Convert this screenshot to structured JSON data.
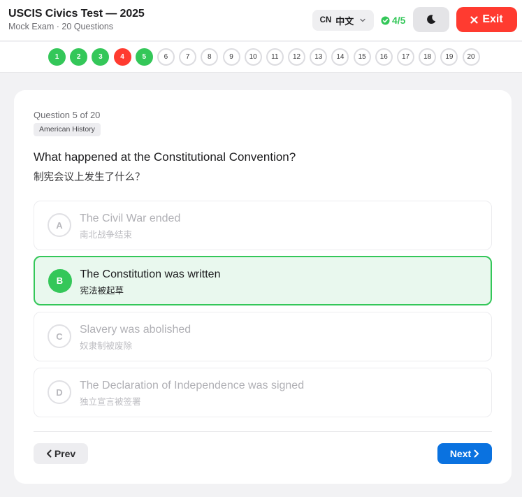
{
  "header": {
    "title": "USCIS Civics Test — 2025",
    "subtitle": "Mock Exam · 20 Questions",
    "language": {
      "code": "CN",
      "label": "中文"
    },
    "score": "4/5",
    "exit_label": "Exit"
  },
  "question_nav": [
    {
      "number": "1",
      "status": "correct"
    },
    {
      "number": "2",
      "status": "correct"
    },
    {
      "number": "3",
      "status": "correct"
    },
    {
      "number": "4",
      "status": "wrong"
    },
    {
      "number": "5",
      "status": "correct"
    },
    {
      "number": "6",
      "status": "unanswered"
    },
    {
      "number": "7",
      "status": "unanswered"
    },
    {
      "number": "8",
      "status": "unanswered"
    },
    {
      "number": "9",
      "status": "unanswered"
    },
    {
      "number": "10",
      "status": "unanswered"
    },
    {
      "number": "11",
      "status": "unanswered"
    },
    {
      "number": "12",
      "status": "unanswered"
    },
    {
      "number": "13",
      "status": "unanswered"
    },
    {
      "number": "14",
      "status": "unanswered"
    },
    {
      "number": "15",
      "status": "unanswered"
    },
    {
      "number": "16",
      "status": "unanswered"
    },
    {
      "number": "17",
      "status": "unanswered"
    },
    {
      "number": "18",
      "status": "unanswered"
    },
    {
      "number": "19",
      "status": "unanswered"
    },
    {
      "number": "20",
      "status": "unanswered"
    }
  ],
  "question": {
    "counter": "Question 5 of 20",
    "category": "American History",
    "text_en": "What happened at the Constitutional Convention?",
    "text_zh": "制宪会议上发生了什么？",
    "options": [
      {
        "letter": "A",
        "text_en": "The Civil War ended",
        "text_zh": "南北战争结束",
        "selected": false
      },
      {
        "letter": "B",
        "text_en": "The Constitution was written",
        "text_zh": "宪法被起草",
        "selected": true
      },
      {
        "letter": "C",
        "text_en": "Slavery was abolished",
        "text_zh": "奴隶制被废除",
        "selected": false
      },
      {
        "letter": "D",
        "text_en": "The Declaration of Independence was signed",
        "text_zh": "独立宣言被签署",
        "selected": false
      }
    ]
  },
  "footer": {
    "prev_label": "Prev",
    "next_label": "Next"
  },
  "colors": {
    "correct": "#34c759",
    "wrong": "#ff3b30",
    "primary": "#0a72e0",
    "selected_bg": "#e9f8ee"
  }
}
